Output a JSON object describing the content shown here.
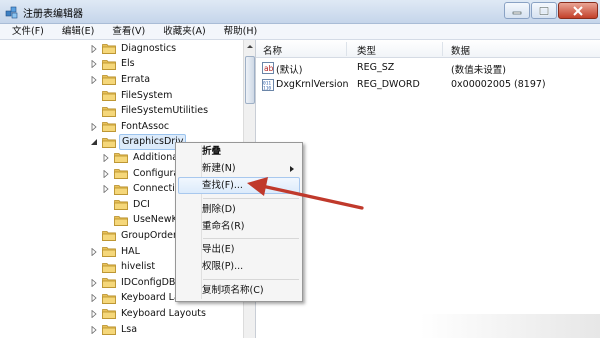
{
  "window": {
    "title": "注册表编辑器"
  },
  "menubar": [
    {
      "label": "文件(F)"
    },
    {
      "label": "编辑(E)"
    },
    {
      "label": "查看(V)"
    },
    {
      "label": "收藏夹(A)"
    },
    {
      "label": "帮助(H)"
    }
  ],
  "tree": {
    "items": [
      {
        "label": "Diagnostics",
        "expander": "collapsed"
      },
      {
        "label": "Els",
        "expander": "collapsed"
      },
      {
        "label": "Errata",
        "expander": "collapsed"
      },
      {
        "label": "FileSystem",
        "expander": "none"
      },
      {
        "label": "FileSystemUtilities",
        "expander": "none"
      },
      {
        "label": "FontAssoc",
        "expander": "collapsed"
      },
      {
        "label": "GraphicsDriv",
        "expander": "expanded",
        "selected": true
      },
      {
        "label": "Additiona",
        "expander": "collapsed",
        "child": true
      },
      {
        "label": "Configura",
        "expander": "collapsed",
        "child": true
      },
      {
        "label": "Connectiv",
        "expander": "collapsed",
        "child": true
      },
      {
        "label": "DCI",
        "expander": "none",
        "child": true
      },
      {
        "label": "UseNewK",
        "expander": "none",
        "child": true
      },
      {
        "label": "GroupOrderl",
        "expander": "none"
      },
      {
        "label": "HAL",
        "expander": "collapsed"
      },
      {
        "label": "hivelist",
        "expander": "none"
      },
      {
        "label": "IDConfigDB",
        "expander": "collapsed"
      },
      {
        "label": "Keyboard Lay",
        "expander": "collapsed"
      },
      {
        "label": "Keyboard Layouts",
        "expander": "collapsed"
      },
      {
        "label": "Lsa",
        "expander": "collapsed"
      }
    ]
  },
  "list": {
    "headers": {
      "name": "名称",
      "type": "类型",
      "data": "数据"
    },
    "rows": [
      {
        "icon": "string-value-icon",
        "name": "(默认)",
        "type": "REG_SZ",
        "data": "(数值未设置)"
      },
      {
        "icon": "binary-value-icon",
        "name": "DxgKrnlVersion",
        "type": "REG_DWORD",
        "data": "0x00002005 (8197)"
      }
    ]
  },
  "context_menu": {
    "collapse": "折叠",
    "new": "新建(N)",
    "find": "查找(F)...",
    "delete": "删除(D)",
    "rename": "重命名(R)",
    "export": "导出(E)",
    "permissions": "权限(P)...",
    "copy_key_name": "复制项名称(C)"
  },
  "colors": {
    "arrow": "#c0392b",
    "selection": "#dcebfb"
  }
}
